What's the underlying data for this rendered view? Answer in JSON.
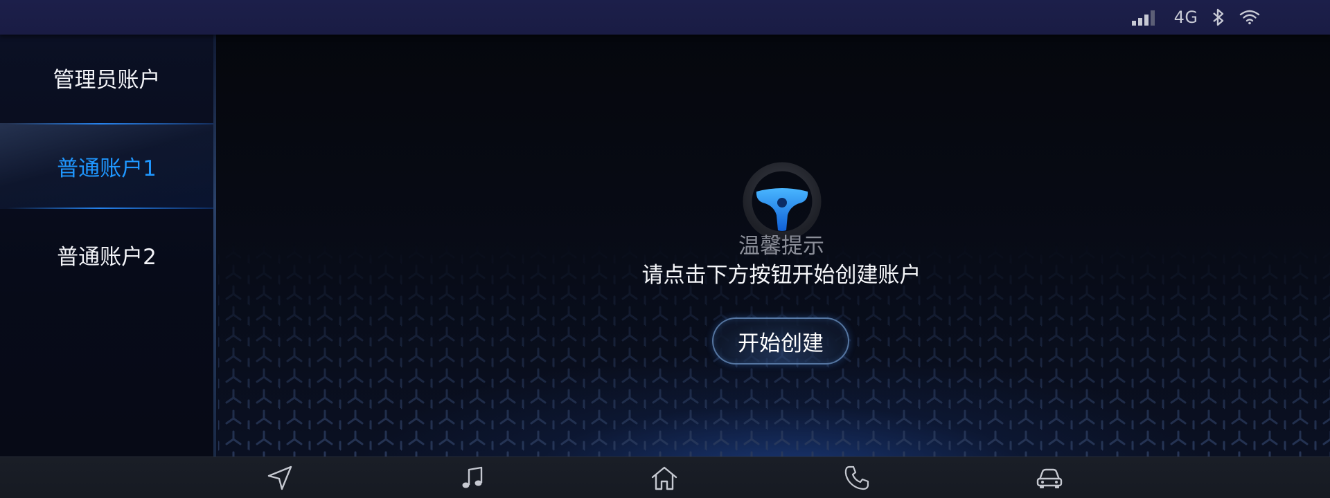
{
  "status_bar": {
    "network": "4G",
    "icons": [
      "signal-icon",
      "bluetooth-icon",
      "wifi-icon"
    ]
  },
  "sidebar": {
    "items": [
      {
        "label": "管理员账户",
        "selected": false
      },
      {
        "label": "普通账户1",
        "selected": true
      },
      {
        "label": "普通账户2",
        "selected": false
      }
    ]
  },
  "main": {
    "icon": "steering-wheel-icon",
    "tip_title": "温馨提示",
    "tip_text": "请点击下方按钮开始创建账户",
    "start_button": "开始创建"
  },
  "bottom_nav": {
    "items": [
      "navigation-icon",
      "music-icon",
      "home-icon",
      "phone-icon",
      "car-icon"
    ]
  },
  "colors": {
    "accent": "#1f97ff",
    "status_bar_bg": "#1c1f4a",
    "nav_bg": "#1a1e27"
  }
}
